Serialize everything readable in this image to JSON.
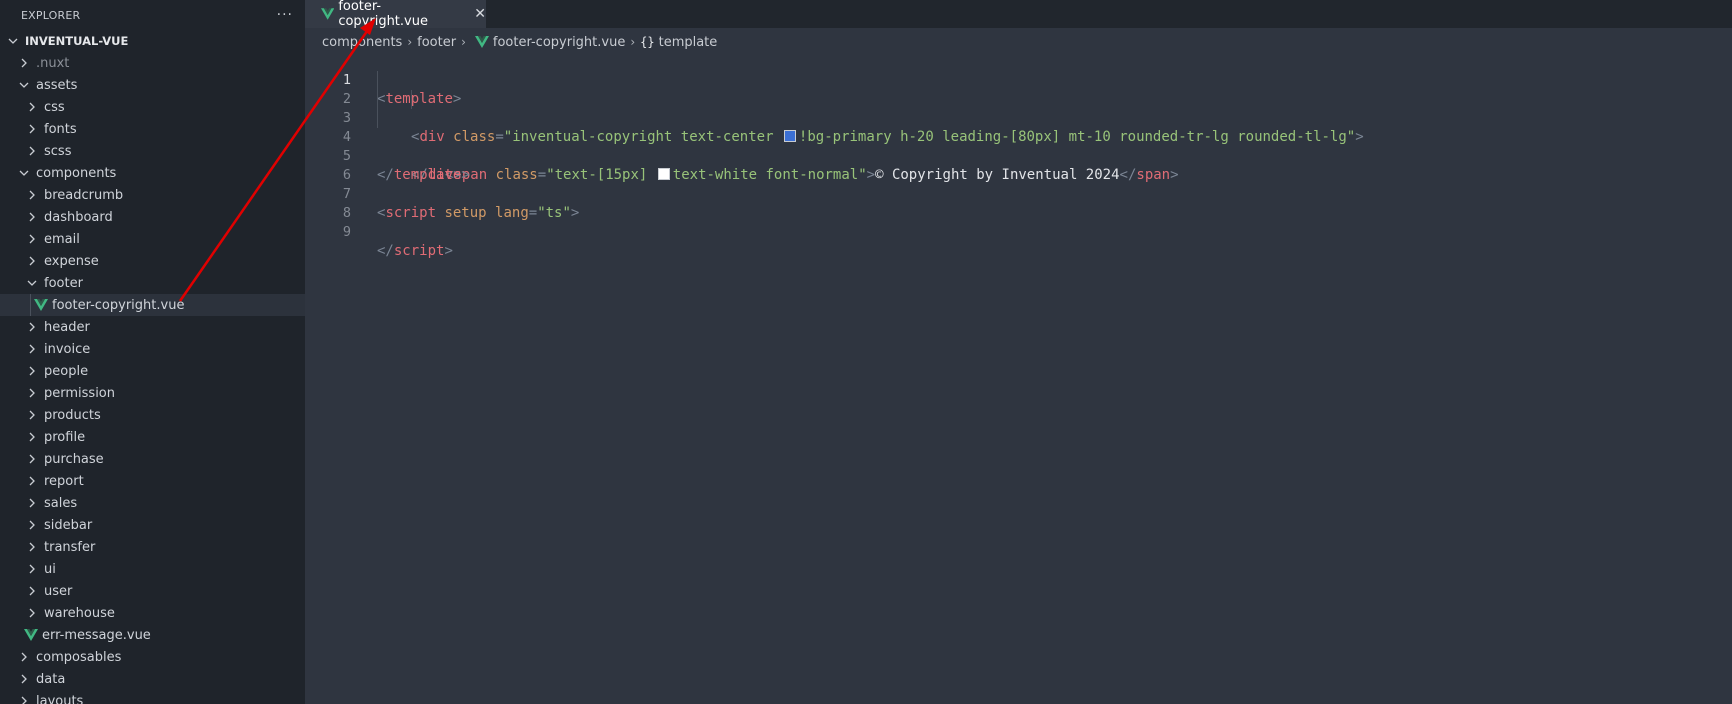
{
  "explorer": {
    "title": "EXPLORER",
    "menu": "···",
    "root": "INVENTUAL-VUE"
  },
  "tree": [
    {
      "label": ".nuxt",
      "kind": "folder-closed",
      "depth": 1,
      "muted": true
    },
    {
      "label": "assets",
      "kind": "folder-open",
      "depth": 1
    },
    {
      "label": "css",
      "kind": "folder-closed",
      "depth": 2
    },
    {
      "label": "fonts",
      "kind": "folder-closed",
      "depth": 2
    },
    {
      "label": "scss",
      "kind": "folder-closed",
      "depth": 2
    },
    {
      "label": "components",
      "kind": "folder-open",
      "depth": 1
    },
    {
      "label": "breadcrumb",
      "kind": "folder-closed",
      "depth": 2
    },
    {
      "label": "dashboard",
      "kind": "folder-closed",
      "depth": 2
    },
    {
      "label": "email",
      "kind": "folder-closed",
      "depth": 2
    },
    {
      "label": "expense",
      "kind": "folder-closed",
      "depth": 2
    },
    {
      "label": "footer",
      "kind": "folder-open",
      "depth": 2
    },
    {
      "label": "footer-copyright.vue",
      "kind": "vue-file",
      "depth": 3,
      "selected": true
    },
    {
      "label": "header",
      "kind": "folder-closed",
      "depth": 2
    },
    {
      "label": "invoice",
      "kind": "folder-closed",
      "depth": 2
    },
    {
      "label": "people",
      "kind": "folder-closed",
      "depth": 2
    },
    {
      "label": "permission",
      "kind": "folder-closed",
      "depth": 2
    },
    {
      "label": "products",
      "kind": "folder-closed",
      "depth": 2
    },
    {
      "label": "profile",
      "kind": "folder-closed",
      "depth": 2
    },
    {
      "label": "purchase",
      "kind": "folder-closed",
      "depth": 2
    },
    {
      "label": "report",
      "kind": "folder-closed",
      "depth": 2
    },
    {
      "label": "sales",
      "kind": "folder-closed",
      "depth": 2
    },
    {
      "label": "sidebar",
      "kind": "folder-closed",
      "depth": 2
    },
    {
      "label": "transfer",
      "kind": "folder-closed",
      "depth": 2
    },
    {
      "label": "ui",
      "kind": "folder-closed",
      "depth": 2
    },
    {
      "label": "user",
      "kind": "folder-closed",
      "depth": 2
    },
    {
      "label": "warehouse",
      "kind": "folder-closed",
      "depth": 2
    },
    {
      "label": "err-message.vue",
      "kind": "vue-file",
      "depth": 2
    },
    {
      "label": "composables",
      "kind": "folder-closed",
      "depth": 1
    },
    {
      "label": "data",
      "kind": "folder-closed",
      "depth": 1
    },
    {
      "label": "layouts",
      "kind": "folder-closed",
      "depth": 1
    }
  ],
  "tab": {
    "label": "footer-copyright.vue",
    "close": "✕"
  },
  "breadcrumb": {
    "items": [
      "components",
      "footer"
    ],
    "file": "footer-copyright.vue",
    "symbol_icon": "{}",
    "symbol": "template",
    "sep": "›"
  },
  "code": {
    "lines": [
      "1",
      "2",
      "3",
      "4",
      "5",
      "6",
      "7",
      "8",
      "9"
    ],
    "l1": {
      "open": "<",
      "tag": "template",
      "close": ">"
    },
    "l2": {
      "open": "<",
      "tag": "div",
      "attr": "class",
      "eq": "=",
      "q": "\"",
      "val_a": "inventual-copyright text-center ",
      "val_b": "!bg-primary h-20 leading-[80px] mt-10 rounded-tr-lg rounded-tl-lg",
      "close": ">",
      "swatch_color": "#3b6fd4"
    },
    "l3": {
      "open": "<",
      "tag": "span",
      "attr": "class",
      "eq": "=",
      "q": "\"",
      "val_a": "text-[15px] ",
      "val_b": "text-white font-normal",
      "close": ">",
      "text": "© Copyright by Inventual 2024",
      "end_open": "</",
      "end_tag": "span",
      "end_close": ">",
      "swatch_color": "#ffffff"
    },
    "l4": {
      "open": "</",
      "tag": "div",
      "close": ">"
    },
    "l5": {
      "open": "</",
      "tag": "template",
      "close": ">"
    },
    "l7": {
      "open": "<",
      "tag": "script",
      "attr1": "setup",
      "attr2": "lang",
      "eq": "=",
      "val": "\"ts\"",
      "close": ">"
    },
    "l9": {
      "open": "</",
      "tag": "script",
      "close": ">"
    }
  },
  "colors": {
    "annotation_arrow": "#e00000",
    "vue_green": "#41b883"
  }
}
